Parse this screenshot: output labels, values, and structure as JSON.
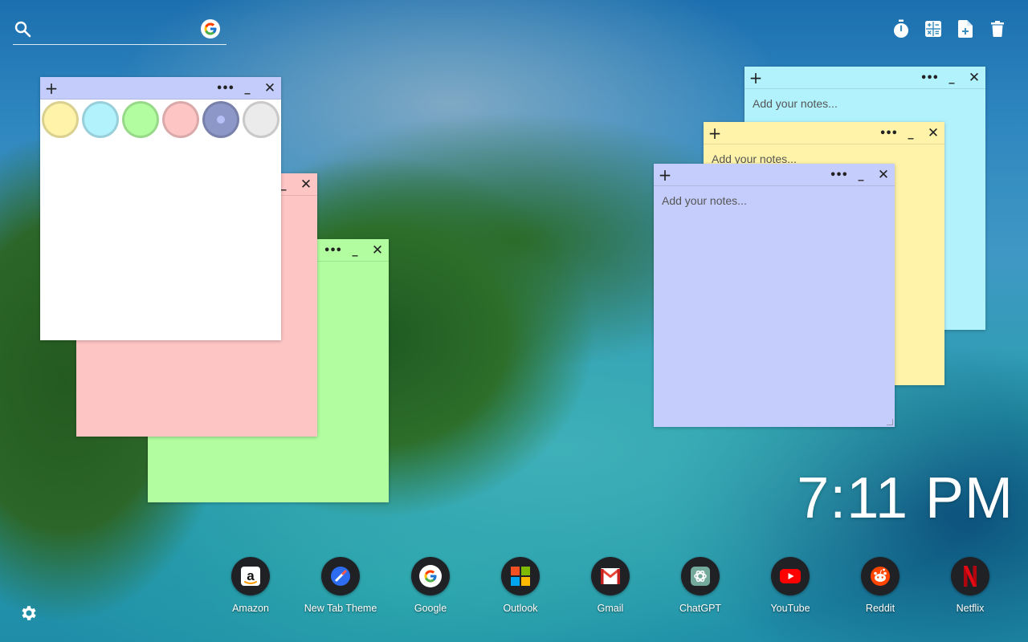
{
  "search": {
    "placeholder": "",
    "engine_icon": "google-g-icon"
  },
  "tools": [
    {
      "name": "timer-icon"
    },
    {
      "name": "calculator-icon"
    },
    {
      "name": "new-note-icon"
    },
    {
      "name": "trash-icon"
    }
  ],
  "notes": {
    "placeholder": "Add your notes...",
    "controls": {
      "add": "+",
      "more": "•••",
      "minimize": "_",
      "close": "✕"
    },
    "picker_colors": [
      {
        "name": "yellow",
        "color": "#fef3a8"
      },
      {
        "name": "cyan",
        "color": "#b1f2fd"
      },
      {
        "name": "green",
        "color": "#b2fda0"
      },
      {
        "name": "pink",
        "color": "#fec5c5"
      },
      {
        "name": "purple",
        "color": "#8d97c8",
        "selected": true
      },
      {
        "name": "white",
        "color": "#ebebeb"
      }
    ],
    "note_colors": {
      "green": "#b2fda0",
      "pink": "#fec5c5",
      "white": "#ffffff",
      "cyan": "#b1f2fd",
      "yellow": "#fef3a8",
      "purple": "#c5cdfc"
    }
  },
  "clock": {
    "time": "7:11 PM"
  },
  "shortcuts": [
    {
      "label": "Amazon",
      "icon": "amazon-icon"
    },
    {
      "label": "New Tab Theme",
      "icon": "new-tab-theme-icon"
    },
    {
      "label": "Google",
      "icon": "google-icon"
    },
    {
      "label": "Outlook",
      "icon": "outlook-icon"
    },
    {
      "label": "Gmail",
      "icon": "gmail-icon"
    },
    {
      "label": "ChatGPT",
      "icon": "chatgpt-icon"
    },
    {
      "label": "YouTube",
      "icon": "youtube-icon"
    },
    {
      "label": "Reddit",
      "icon": "reddit-icon"
    },
    {
      "label": "Netflix",
      "icon": "netflix-icon"
    }
  ],
  "settings": {
    "icon": "gear-icon"
  }
}
